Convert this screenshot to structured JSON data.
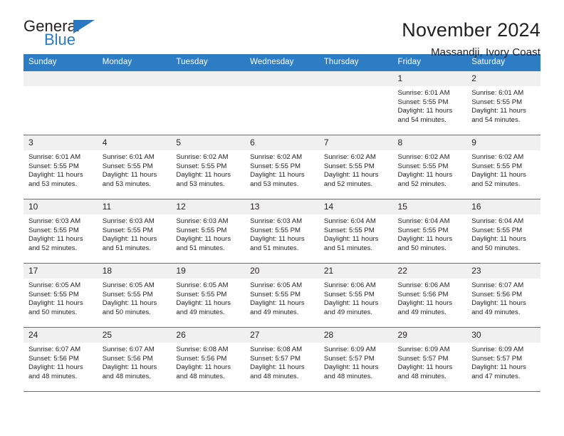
{
  "brand": {
    "name_part1": "General",
    "name_part2": "Blue",
    "accent_color": "#2a78c2"
  },
  "header": {
    "month_title": "November 2024",
    "location": "Massandji, Ivory Coast"
  },
  "calendar": {
    "header_color": "#2e7cc4",
    "weekday_headers": [
      "Sunday",
      "Monday",
      "Tuesday",
      "Wednesday",
      "Thursday",
      "Friday",
      "Saturday"
    ],
    "weeks": [
      [
        {
          "day": "",
          "sunrise": "",
          "sunset": "",
          "daylight_line1": "",
          "daylight_line2": "",
          "empty": true
        },
        {
          "day": "",
          "sunrise": "",
          "sunset": "",
          "daylight_line1": "",
          "daylight_line2": "",
          "empty": true
        },
        {
          "day": "",
          "sunrise": "",
          "sunset": "",
          "daylight_line1": "",
          "daylight_line2": "",
          "empty": true
        },
        {
          "day": "",
          "sunrise": "",
          "sunset": "",
          "daylight_line1": "",
          "daylight_line2": "",
          "empty": true
        },
        {
          "day": "",
          "sunrise": "",
          "sunset": "",
          "daylight_line1": "",
          "daylight_line2": "",
          "empty": true
        },
        {
          "day": "1",
          "sunrise": "Sunrise: 6:01 AM",
          "sunset": "Sunset: 5:55 PM",
          "daylight_line1": "Daylight: 11 hours",
          "daylight_line2": "and 54 minutes."
        },
        {
          "day": "2",
          "sunrise": "Sunrise: 6:01 AM",
          "sunset": "Sunset: 5:55 PM",
          "daylight_line1": "Daylight: 11 hours",
          "daylight_line2": "and 54 minutes."
        }
      ],
      [
        {
          "day": "3",
          "sunrise": "Sunrise: 6:01 AM",
          "sunset": "Sunset: 5:55 PM",
          "daylight_line1": "Daylight: 11 hours",
          "daylight_line2": "and 53 minutes."
        },
        {
          "day": "4",
          "sunrise": "Sunrise: 6:01 AM",
          "sunset": "Sunset: 5:55 PM",
          "daylight_line1": "Daylight: 11 hours",
          "daylight_line2": "and 53 minutes."
        },
        {
          "day": "5",
          "sunrise": "Sunrise: 6:02 AM",
          "sunset": "Sunset: 5:55 PM",
          "daylight_line1": "Daylight: 11 hours",
          "daylight_line2": "and 53 minutes."
        },
        {
          "day": "6",
          "sunrise": "Sunrise: 6:02 AM",
          "sunset": "Sunset: 5:55 PM",
          "daylight_line1": "Daylight: 11 hours",
          "daylight_line2": "and 53 minutes."
        },
        {
          "day": "7",
          "sunrise": "Sunrise: 6:02 AM",
          "sunset": "Sunset: 5:55 PM",
          "daylight_line1": "Daylight: 11 hours",
          "daylight_line2": "and 52 minutes."
        },
        {
          "day": "8",
          "sunrise": "Sunrise: 6:02 AM",
          "sunset": "Sunset: 5:55 PM",
          "daylight_line1": "Daylight: 11 hours",
          "daylight_line2": "and 52 minutes."
        },
        {
          "day": "9",
          "sunrise": "Sunrise: 6:02 AM",
          "sunset": "Sunset: 5:55 PM",
          "daylight_line1": "Daylight: 11 hours",
          "daylight_line2": "and 52 minutes."
        }
      ],
      [
        {
          "day": "10",
          "sunrise": "Sunrise: 6:03 AM",
          "sunset": "Sunset: 5:55 PM",
          "daylight_line1": "Daylight: 11 hours",
          "daylight_line2": "and 52 minutes."
        },
        {
          "day": "11",
          "sunrise": "Sunrise: 6:03 AM",
          "sunset": "Sunset: 5:55 PM",
          "daylight_line1": "Daylight: 11 hours",
          "daylight_line2": "and 51 minutes."
        },
        {
          "day": "12",
          "sunrise": "Sunrise: 6:03 AM",
          "sunset": "Sunset: 5:55 PM",
          "daylight_line1": "Daylight: 11 hours",
          "daylight_line2": "and 51 minutes."
        },
        {
          "day": "13",
          "sunrise": "Sunrise: 6:03 AM",
          "sunset": "Sunset: 5:55 PM",
          "daylight_line1": "Daylight: 11 hours",
          "daylight_line2": "and 51 minutes."
        },
        {
          "day": "14",
          "sunrise": "Sunrise: 6:04 AM",
          "sunset": "Sunset: 5:55 PM",
          "daylight_line1": "Daylight: 11 hours",
          "daylight_line2": "and 51 minutes."
        },
        {
          "day": "15",
          "sunrise": "Sunrise: 6:04 AM",
          "sunset": "Sunset: 5:55 PM",
          "daylight_line1": "Daylight: 11 hours",
          "daylight_line2": "and 50 minutes."
        },
        {
          "day": "16",
          "sunrise": "Sunrise: 6:04 AM",
          "sunset": "Sunset: 5:55 PM",
          "daylight_line1": "Daylight: 11 hours",
          "daylight_line2": "and 50 minutes."
        }
      ],
      [
        {
          "day": "17",
          "sunrise": "Sunrise: 6:05 AM",
          "sunset": "Sunset: 5:55 PM",
          "daylight_line1": "Daylight: 11 hours",
          "daylight_line2": "and 50 minutes."
        },
        {
          "day": "18",
          "sunrise": "Sunrise: 6:05 AM",
          "sunset": "Sunset: 5:55 PM",
          "daylight_line1": "Daylight: 11 hours",
          "daylight_line2": "and 50 minutes."
        },
        {
          "day": "19",
          "sunrise": "Sunrise: 6:05 AM",
          "sunset": "Sunset: 5:55 PM",
          "daylight_line1": "Daylight: 11 hours",
          "daylight_line2": "and 49 minutes."
        },
        {
          "day": "20",
          "sunrise": "Sunrise: 6:05 AM",
          "sunset": "Sunset: 5:55 PM",
          "daylight_line1": "Daylight: 11 hours",
          "daylight_line2": "and 49 minutes."
        },
        {
          "day": "21",
          "sunrise": "Sunrise: 6:06 AM",
          "sunset": "Sunset: 5:55 PM",
          "daylight_line1": "Daylight: 11 hours",
          "daylight_line2": "and 49 minutes."
        },
        {
          "day": "22",
          "sunrise": "Sunrise: 6:06 AM",
          "sunset": "Sunset: 5:56 PM",
          "daylight_line1": "Daylight: 11 hours",
          "daylight_line2": "and 49 minutes."
        },
        {
          "day": "23",
          "sunrise": "Sunrise: 6:07 AM",
          "sunset": "Sunset: 5:56 PM",
          "daylight_line1": "Daylight: 11 hours",
          "daylight_line2": "and 49 minutes."
        }
      ],
      [
        {
          "day": "24",
          "sunrise": "Sunrise: 6:07 AM",
          "sunset": "Sunset: 5:56 PM",
          "daylight_line1": "Daylight: 11 hours",
          "daylight_line2": "and 48 minutes."
        },
        {
          "day": "25",
          "sunrise": "Sunrise: 6:07 AM",
          "sunset": "Sunset: 5:56 PM",
          "daylight_line1": "Daylight: 11 hours",
          "daylight_line2": "and 48 minutes."
        },
        {
          "day": "26",
          "sunrise": "Sunrise: 6:08 AM",
          "sunset": "Sunset: 5:56 PM",
          "daylight_line1": "Daylight: 11 hours",
          "daylight_line2": "and 48 minutes."
        },
        {
          "day": "27",
          "sunrise": "Sunrise: 6:08 AM",
          "sunset": "Sunset: 5:57 PM",
          "daylight_line1": "Daylight: 11 hours",
          "daylight_line2": "and 48 minutes."
        },
        {
          "day": "28",
          "sunrise": "Sunrise: 6:09 AM",
          "sunset": "Sunset: 5:57 PM",
          "daylight_line1": "Daylight: 11 hours",
          "daylight_line2": "and 48 minutes."
        },
        {
          "day": "29",
          "sunrise": "Sunrise: 6:09 AM",
          "sunset": "Sunset: 5:57 PM",
          "daylight_line1": "Daylight: 11 hours",
          "daylight_line2": "and 48 minutes."
        },
        {
          "day": "30",
          "sunrise": "Sunrise: 6:09 AM",
          "sunset": "Sunset: 5:57 PM",
          "daylight_line1": "Daylight: 11 hours",
          "daylight_line2": "and 47 minutes."
        }
      ]
    ]
  }
}
